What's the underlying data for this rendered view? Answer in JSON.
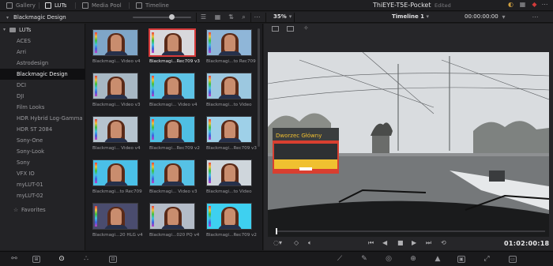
{
  "top_tabs": [
    {
      "label": "Gallery",
      "active": false
    },
    {
      "label": "LUTs",
      "active": true
    },
    {
      "label": "Media Pool",
      "active": false
    },
    {
      "label": "Timeline",
      "active": false
    }
  ],
  "project": {
    "title": "ThiEYE-T5E-Pocket",
    "state": "Edited"
  },
  "breadcrumb": {
    "folder": "Blackmagic Design"
  },
  "viewer": {
    "zoom": "35%",
    "timeline_name": "Timeline 1",
    "timecode_top": "00:00:00:00",
    "timecode_bottom": "01:02:00:18",
    "bus_text": "Dworzec Główny"
  },
  "lut_tree": {
    "root": "LUTs",
    "items": [
      {
        "label": "ACES"
      },
      {
        "label": "Arri"
      },
      {
        "label": "Astrodesign"
      },
      {
        "label": "Blackmagic Design",
        "selected": true
      },
      {
        "label": "DCI"
      },
      {
        "label": "DJI"
      },
      {
        "label": "Film Looks"
      },
      {
        "label": "HDR Hybrid Log-Gamma"
      },
      {
        "label": "HDR ST 2084"
      },
      {
        "label": "Sony-One"
      },
      {
        "label": "Sony-Look"
      },
      {
        "label": "Sony"
      },
      {
        "label": "VFX IO"
      },
      {
        "label": "myLUT-01"
      },
      {
        "label": "myLUT-02"
      }
    ],
    "favorites": "Favorites"
  },
  "lut_grid": [
    {
      "caption": "Blackmagi... Video v4",
      "tint": "#7fa6c8"
    },
    {
      "caption": "Blackmagi...Rec709 v3",
      "tint": "#d8d8dc",
      "selected": true
    },
    {
      "caption": "Blackmagi...to Rec709",
      "tint": "#8fb6d8"
    },
    {
      "caption": "Blackmagi... Video v3",
      "tint": "#a8b8c4"
    },
    {
      "caption": "Blackmagi... Video v4",
      "tint": "#5ec4e6"
    },
    {
      "caption": "Blackmagi...to Video",
      "tint": "#9cc8e0"
    },
    {
      "caption": "Blackmagi... Video v4",
      "tint": "#b6c4cf"
    },
    {
      "caption": "Blackmagi...Rec709 v2",
      "tint": "#4fbfe3"
    },
    {
      "caption": "Blackmagi...Rec709 v3",
      "tint": "#9ed0e8"
    },
    {
      "caption": "Blackmagi...to Rec709",
      "tint": "#4ac0e8"
    },
    {
      "caption": "Blackmagi... Video v3",
      "tint": "#56c2e6"
    },
    {
      "caption": "Blackmagi...to Video",
      "tint": "#cfd6dc"
    },
    {
      "caption": "Blackmagi...20 HLG v4",
      "tint": "#4a4c6e"
    },
    {
      "caption": "Blackmagi...020 PQ v4",
      "tint": "#b4bcc8"
    },
    {
      "caption": "Blackmagi...Rec709 v2",
      "tint": "#3ed0f0"
    }
  ]
}
